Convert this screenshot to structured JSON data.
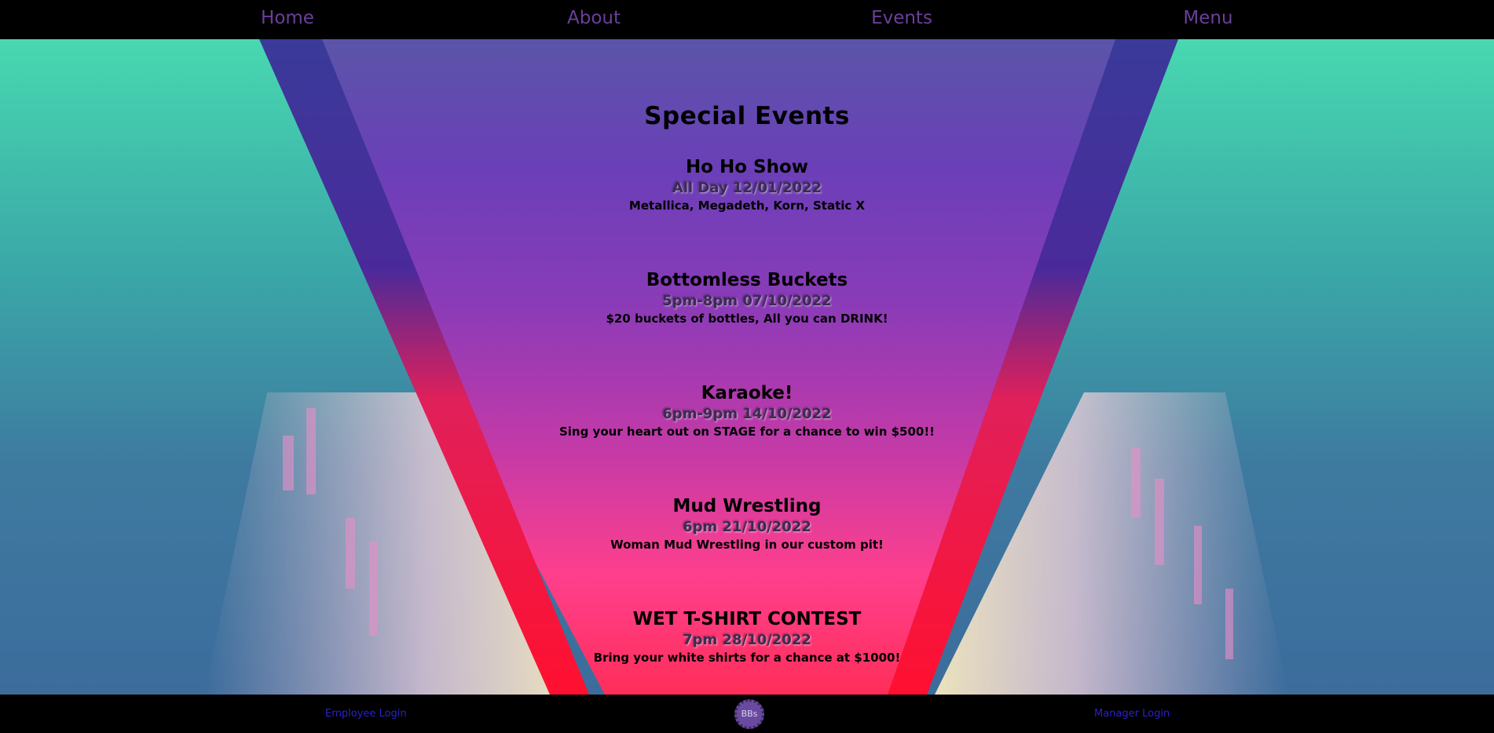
{
  "nav": {
    "home": "Home",
    "about": "About",
    "events": "Events",
    "menu": "Menu"
  },
  "page": {
    "title": "Special Events"
  },
  "events": [
    {
      "name": "Ho Ho Show",
      "date": "All Day 12/01/2022",
      "desc": "Metallica, Megadeth, Korn, Static X"
    },
    {
      "name": "Bottomless Buckets",
      "date": "5pm-8pm 07/10/2022",
      "desc": "$20 buckets of bottles, All you can DRINK!"
    },
    {
      "name": "Karaoke!",
      "date": "6pm-9pm 14/10/2022",
      "desc": "Sing your heart out on STAGE for a chance to win $500!!"
    },
    {
      "name": "Mud Wrestling",
      "date": "6pm 21/10/2022",
      "desc": "Woman Mud Wrestling in our custom pit!"
    },
    {
      "name": "WET T-SHIRT CONTEST",
      "date": "7pm 28/10/2022",
      "desc": "Bring your white shirts for a chance at $1000!"
    }
  ],
  "footer": {
    "employee_login": "Employee Login",
    "manager_login": "Manager Login",
    "logo_text": "BBs"
  },
  "colors": {
    "nav_text": "#6b3f9a",
    "footer_link": "#2a22c8",
    "background": "#000000"
  }
}
